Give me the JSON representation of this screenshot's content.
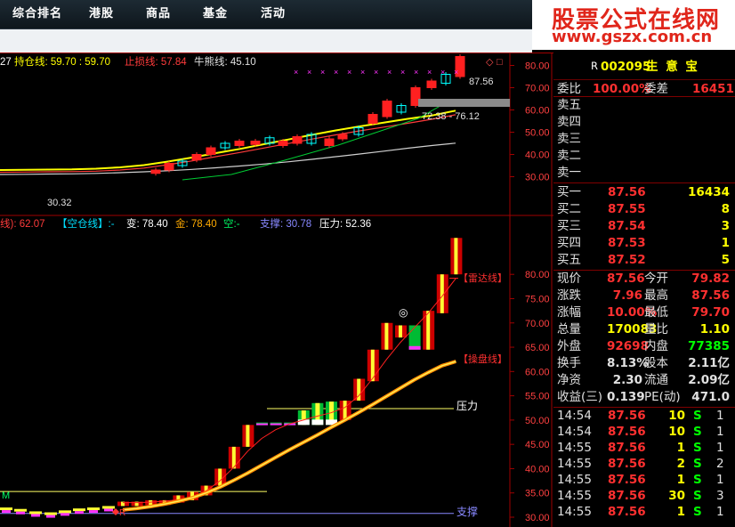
{
  "nav": {
    "tabs": [
      "综合排名",
      "港股",
      "商品",
      "基金",
      "活动"
    ]
  },
  "watermark": {
    "line1": "股票公式在线网",
    "line2": "www.gszx.com.cn"
  },
  "upper": {
    "ma_prefix": "27",
    "legend": [
      {
        "label": "持仓线: 59.70 : 59.70",
        "color": "#ffff00"
      },
      {
        "label": "止损线: 57.84",
        "color": "#ff3b3b"
      },
      {
        "label": "牛熊线: 45.10",
        "color": "#e0e0e0"
      }
    ],
    "corner_icons": [
      "◇",
      "□"
    ],
    "price_label": "87.56",
    "range_label": "72.38 - 76.12",
    "low_label": "30.32",
    "yticks": [
      "80.00",
      "70.00",
      "60.00",
      "50.00",
      "40.00",
      "30.00"
    ]
  },
  "lower": {
    "legend": [
      {
        "label": "线): 62.07",
        "color": "#ff3b3b"
      },
      {
        "label": "【空仓线】:-",
        "color": "#00e0ff"
      },
      {
        "label": "变: 78.40",
        "color": "#ffffff"
      },
      {
        "label": "金: 78.40",
        "color": "#ffaa00"
      },
      {
        "label": "空:-",
        "color": "#00ff66"
      },
      {
        "label": "支撑: 30.78",
        "color": "#8888ff"
      },
      {
        "label": "压力: 52.36",
        "color": "#ffffff"
      }
    ],
    "annotations": {
      "radar": "【雷达线】",
      "operate": "【操盘线】",
      "pressure": "压力",
      "support": "支撑",
      "circle": "◎",
      "m": "M",
      "r": "R"
    },
    "yticks": [
      "80.00",
      "75.00",
      "70.00",
      "65.00",
      "60.00",
      "55.00",
      "50.00",
      "45.00",
      "40.00",
      "35.00",
      "30.00"
    ]
  },
  "quote": {
    "code": "002095",
    "name": "生 意 宝",
    "r_mark": "R",
    "ratio_label": "委比",
    "ratio": "100.00%",
    "diff_label": "委差",
    "diff": "16451",
    "asks": [
      {
        "label": "卖五",
        "price": "",
        "vol": ""
      },
      {
        "label": "卖四",
        "price": "",
        "vol": ""
      },
      {
        "label": "卖三",
        "price": "",
        "vol": ""
      },
      {
        "label": "卖二",
        "price": "",
        "vol": ""
      },
      {
        "label": "卖一",
        "price": "",
        "vol": ""
      }
    ],
    "bids": [
      {
        "label": "买一",
        "price": "87.56",
        "vol": "16434"
      },
      {
        "label": "买二",
        "price": "87.55",
        "vol": "8"
      },
      {
        "label": "买三",
        "price": "87.54",
        "vol": "3"
      },
      {
        "label": "买四",
        "price": "87.53",
        "vol": "1"
      },
      {
        "label": "买五",
        "price": "87.52",
        "vol": "5"
      }
    ],
    "stats": [
      {
        "l1": "现价",
        "v1": "87.56",
        "c1": "#ff3030",
        "l2": "今开",
        "v2": "79.82",
        "c2": "#ff3030"
      },
      {
        "l1": "涨跌",
        "v1": "7.96",
        "c1": "#ff3030",
        "l2": "最高",
        "v2": "87.56",
        "c2": "#ff3030"
      },
      {
        "l1": "涨幅",
        "v1": "10.00%",
        "c1": "#ff3030",
        "l2": "最低",
        "v2": "79.70",
        "c2": "#ff3030"
      },
      {
        "l1": "总量",
        "v1": "170083",
        "c1": "#ffff00",
        "l2": "量比",
        "v2": "1.10",
        "c2": "#ffff00"
      },
      {
        "l1": "外盘",
        "v1": "92698",
        "c1": "#ff3030",
        "l2": "内盘",
        "v2": "77385",
        "c2": "#00ff00"
      },
      {
        "l1": "换手",
        "v1": "8.13%",
        "c1": "#e0e0e0",
        "l2": "股本",
        "v2": "2.11亿",
        "c2": "#e0e0e0"
      },
      {
        "l1": "净资",
        "v1": "2.30",
        "c1": "#e0e0e0",
        "l2": "流通",
        "v2": "2.09亿",
        "c2": "#e0e0e0"
      },
      {
        "l1": "收益(三)",
        "v1": "0.139",
        "c1": "#e0e0e0",
        "l2": "PE(动)",
        "v2": "471.0",
        "c2": "#e0e0e0"
      }
    ],
    "ticks": [
      {
        "time": "14:54",
        "price": "87.56",
        "vol": "10",
        "side": "S",
        "num": "1"
      },
      {
        "time": "14:54",
        "price": "87.56",
        "vol": "10",
        "side": "S",
        "num": "1"
      },
      {
        "time": "14:55",
        "price": "87.56",
        "vol": "1",
        "side": "S",
        "num": "1"
      },
      {
        "time": "14:55",
        "price": "87.56",
        "vol": "2",
        "side": "S",
        "num": "2"
      },
      {
        "time": "14:55",
        "price": "87.56",
        "vol": "1",
        "side": "S",
        "num": "1"
      },
      {
        "time": "14:55",
        "price": "87.56",
        "vol": "30",
        "side": "S",
        "num": "3"
      },
      {
        "time": "14:55",
        "price": "87.56",
        "vol": "1",
        "side": "S",
        "num": "1"
      }
    ]
  },
  "chart_data": [
    {
      "type": "candlestick",
      "panel": "upper",
      "series": [
        {
          "name": "持仓线",
          "values": [
            33.0,
            33.1,
            33.2,
            33.3,
            33.6,
            34.2,
            35.2,
            36.8,
            38.6,
            40.6,
            42.5,
            44.6,
            46.7,
            48.8,
            50.8,
            52.6,
            54.3,
            56.0,
            57.5,
            59.7
          ]
        },
        {
          "name": "止损线",
          "values": [
            32.0,
            32.1,
            32.2,
            32.3,
            32.5,
            33.0,
            33.9,
            35.4,
            37.1,
            39.0,
            40.9,
            42.9,
            44.9,
            46.9,
            48.8,
            50.6,
            52.3,
            54.0,
            55.8,
            57.84
          ]
        },
        {
          "name": "牛熊线",
          "values": [
            31.0,
            31.1,
            31.2,
            31.3,
            31.5,
            31.8,
            32.2,
            32.7,
            33.3,
            34.0,
            34.8,
            35.7,
            36.7,
            37.8,
            39.0,
            40.2,
            41.5,
            42.8,
            44.0,
            45.1
          ]
        }
      ],
      "price_labels": [
        "87.56",
        "72.38 - 76.12",
        "30.32"
      ],
      "ylim": [
        27,
        90
      ]
    },
    {
      "type": "bar",
      "panel": "lower",
      "bars": [
        {
          "open": 32.3,
          "close": 33.2,
          "style": "red"
        },
        {
          "open": 32.3,
          "close": 33.2,
          "style": "red"
        },
        {
          "open": 32.5,
          "close": 33.5,
          "style": "red"
        },
        {
          "open": 32.5,
          "close": 33.5,
          "style": "red"
        },
        {
          "open": 33.0,
          "close": 34.5,
          "style": "red"
        },
        {
          "open": 33.5,
          "close": 35.2,
          "style": "red"
        },
        {
          "open": 34.5,
          "close": 36.5,
          "style": "red"
        },
        {
          "open": 36.5,
          "close": 40.0,
          "style": "red"
        },
        {
          "open": 40.0,
          "close": 44.5,
          "style": "red"
        },
        {
          "open": 44.5,
          "close": 49.0,
          "style": "red"
        },
        {
          "open": 49.0,
          "close": 49.5,
          "style": "flat"
        },
        {
          "open": 49.0,
          "close": 49.5,
          "style": "flat"
        },
        {
          "open": 49.0,
          "close": 49.5,
          "style": "flat"
        },
        {
          "open": 49.0,
          "close": 52.0,
          "style": "mixed"
        },
        {
          "open": 49.0,
          "close": 53.5,
          "style": "mixed"
        },
        {
          "open": 49.0,
          "close": 53.8,
          "style": "mixed"
        },
        {
          "open": 50.0,
          "close": 54.0,
          "style": "red"
        },
        {
          "open": 54.0,
          "close": 58.5,
          "style": "red"
        },
        {
          "open": 58.0,
          "close": 64.5,
          "style": "red"
        },
        {
          "open": 64.5,
          "close": 70.0,
          "style": "red"
        },
        {
          "open": 67.0,
          "close": 69.5,
          "style": "red"
        },
        {
          "open": 64.5,
          "close": 69.5,
          "style": "green"
        },
        {
          "open": 64.5,
          "close": 72.5,
          "style": "red"
        },
        {
          "open": 72.0,
          "close": 80.0,
          "style": "red"
        },
        {
          "open": 80.0,
          "close": 87.5,
          "style": "red"
        }
      ],
      "series": [
        {
          "name": "雷达线",
          "values": [
            33.0,
            33.0,
            33.1,
            33.3,
            33.6,
            34.2,
            35.4,
            37.5,
            40.3,
            43.6,
            46.2,
            48.0,
            49.2,
            50.0,
            50.8,
            51.5,
            52.6,
            55.0,
            58.6,
            62.5,
            66.0,
            69.0,
            72.0,
            75.5,
            79.2
          ]
        },
        {
          "name": "操盘线",
          "values": [
            31.5,
            31.8,
            32.2,
            32.7,
            33.3,
            34.0,
            35.0,
            36.2,
            37.6,
            39.1,
            40.7,
            42.3,
            43.9,
            45.4,
            46.9,
            48.5,
            50.0,
            51.6,
            53.2,
            54.9,
            56.6,
            58.3,
            59.8,
            61.2,
            62.07
          ]
        }
      ],
      "hlines": [
        {
          "label": "压力",
          "value": 52.36
        },
        {
          "label": "支撑",
          "value": 30.78
        }
      ],
      "ylim": [
        29.5,
        88
      ]
    }
  ]
}
